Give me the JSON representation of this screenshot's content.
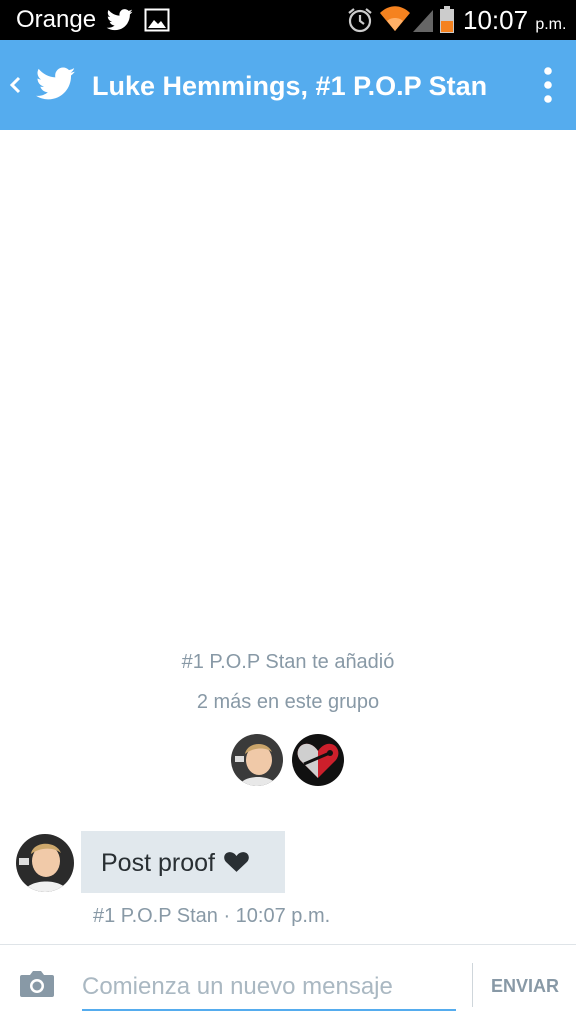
{
  "status_bar": {
    "carrier": "Orange",
    "time": "10:07",
    "time_suffix": "p.m.",
    "icons": [
      "twitter-icon",
      "image-icon",
      "alarm-icon",
      "wifi-icon",
      "signal-icon",
      "battery-icon"
    ]
  },
  "action_bar": {
    "title": "Luke Hemmings, #1 P.O.P Stan",
    "icons": [
      "back-icon",
      "twitter-icon",
      "overflow-menu-icon"
    ]
  },
  "conversation": {
    "system_line_1": "#1 P.O.P Stan te añadió",
    "system_line_2": "2 más en este grupo",
    "members": [
      "member-avatar-luke",
      "member-avatar-stan"
    ],
    "messages": [
      {
        "text": "Post proof",
        "icon": "heart-icon",
        "meta": "#1 P.O.P Stan · 10:07 p.m."
      }
    ]
  },
  "composer": {
    "placeholder": "Comienza un nuevo mensaje",
    "send_label": "ENVIAR",
    "icon": "camera-icon"
  },
  "colors": {
    "accent": "#55acee",
    "status_bar_bg": "#000000",
    "bubble_bg": "#e1e8ed",
    "muted_text": "#8899a6",
    "wifi_orange": "#f5821f"
  }
}
